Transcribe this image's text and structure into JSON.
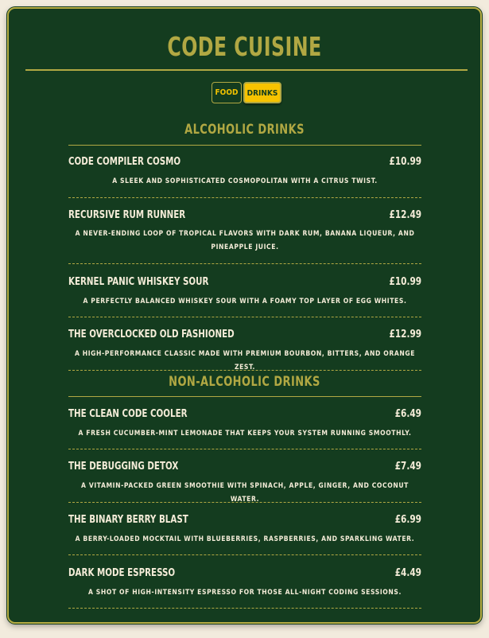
{
  "title": "CODE CUISINE",
  "tabs": [
    {
      "label": "FOOD",
      "active": false
    },
    {
      "label": "DRINKS",
      "active": true
    }
  ],
  "colors": {
    "background": "#f2ebdd",
    "card": "#143c1f",
    "accent": "#b1a843",
    "active_tab": "#f7c300",
    "text": "#f4ecd8"
  },
  "sections": [
    {
      "title": "ALCOHOLIC DRINKS",
      "items": [
        {
          "name": "CODE COMPILER COSMO",
          "price": "£10.99",
          "description": "A SLEEK AND SOPHISTICATED COSMOPOLITAN WITH A CITRUS TWIST."
        },
        {
          "name": "RECURSIVE RUM RUNNER",
          "price": "£12.49",
          "description": "A NEVER-ENDING LOOP OF TROPICAL FLAVORS WITH DARK RUM, BANANA LIQUEUR, AND PINEAPPLE JUICE."
        },
        {
          "name": "KERNEL PANIC WHISKEY SOUR",
          "price": "£10.99",
          "description": "A PERFECTLY BALANCED WHISKEY SOUR WITH A FOAMY TOP LAYER OF EGG WHITES."
        },
        {
          "name": "THE OVERCLOCKED OLD FASHIONED",
          "price": "£12.99",
          "description": "A HIGH-PERFORMANCE CLASSIC MADE WITH PREMIUM BOURBON, BITTERS, AND ORANGE ZEST."
        }
      ]
    },
    {
      "title": "NON-ALCOHOLIC DRINKS",
      "items": [
        {
          "name": "THE CLEAN CODE COOLER",
          "price": "£6.49",
          "description": "A FRESH CUCUMBER-MINT LEMONADE THAT KEEPS YOUR SYSTEM RUNNING SMOOTHLY."
        },
        {
          "name": "THE DEBUGGING DETOX",
          "price": "£7.49",
          "description": "A VITAMIN-PACKED GREEN SMOOTHIE WITH SPINACH, APPLE, GINGER, AND COCONUT WATER."
        },
        {
          "name": "THE BINARY BERRY BLAST",
          "price": "£6.99",
          "description": "A BERRY-LOADED MOCKTAIL WITH BLUEBERRIES, RASPBERRIES, AND SPARKLING WATER."
        },
        {
          "name": "DARK MODE ESPRESSO",
          "price": "£4.49",
          "description": "A SHOT OF HIGH-INTENSITY ESPRESSO FOR THOSE ALL-NIGHT CODING SESSIONS."
        }
      ]
    }
  ]
}
